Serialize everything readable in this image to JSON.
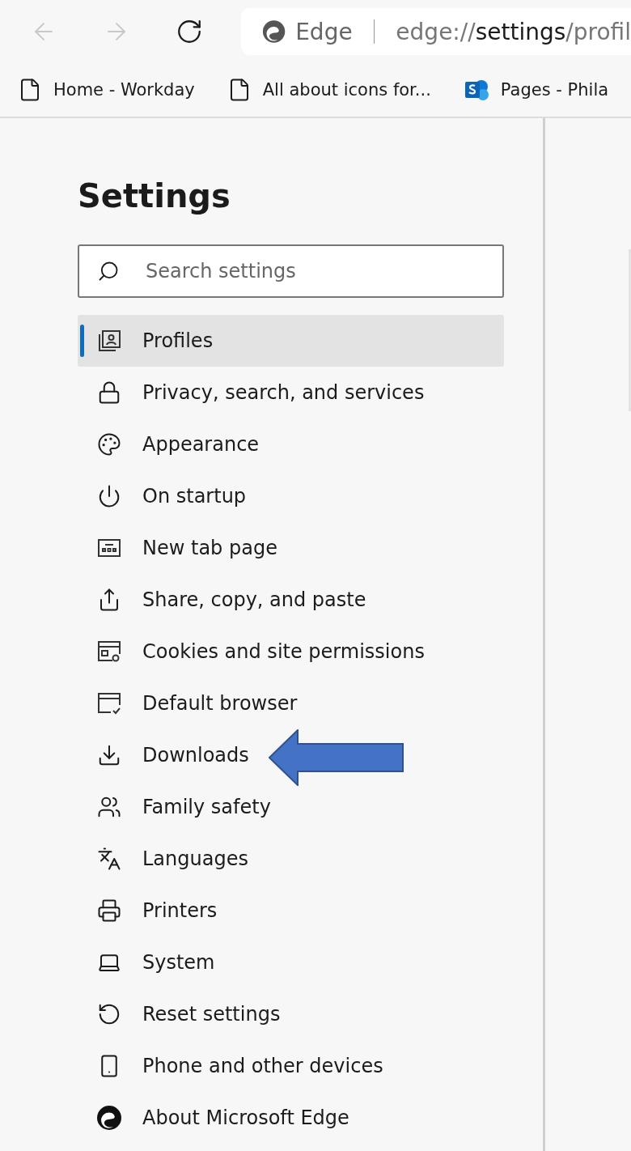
{
  "toolbar": {
    "back": {
      "disabled": true
    },
    "forward": {
      "disabled": true
    },
    "address_bar": {
      "site_label": "Edge",
      "url": "edge://**settings**/profil"
    }
  },
  "favorites_bar": [
    {
      "kind": "page",
      "label": "Home - Workday"
    },
    {
      "kind": "page",
      "label": "All about icons for..."
    },
    {
      "kind": "sharepoint",
      "label": "Pages - Phila"
    }
  ],
  "settings": {
    "title": "Settings",
    "search": {
      "placeholder": "Search settings"
    },
    "nav_items": [
      {
        "label": "Profiles",
        "selected": true,
        "pointed": false
      },
      {
        "label": "Privacy, search, and services",
        "selected": false,
        "pointed": false
      },
      {
        "label": "Appearance",
        "selected": false,
        "pointed": false
      },
      {
        "label": "On startup",
        "selected": false,
        "pointed": false
      },
      {
        "label": "New tab page",
        "selected": false,
        "pointed": false
      },
      {
        "label": "Share, copy, and paste",
        "selected": false,
        "pointed": false
      },
      {
        "label": "Cookies and site permissions",
        "selected": false,
        "pointed": false
      },
      {
        "label": "Default browser",
        "selected": false,
        "pointed": false
      },
      {
        "label": "Downloads",
        "selected": false,
        "pointed": true
      },
      {
        "label": "Family safety",
        "selected": false,
        "pointed": false
      },
      {
        "label": "Languages",
        "selected": false,
        "pointed": false
      },
      {
        "label": "Printers",
        "selected": false,
        "pointed": false
      },
      {
        "label": "System",
        "selected": false,
        "pointed": false
      },
      {
        "label": "Reset settings",
        "selected": false,
        "pointed": false
      },
      {
        "label": "Phone and other devices",
        "selected": false,
        "pointed": false
      },
      {
        "label": "About Microsoft Edge",
        "selected": false,
        "pointed": false
      }
    ]
  }
}
